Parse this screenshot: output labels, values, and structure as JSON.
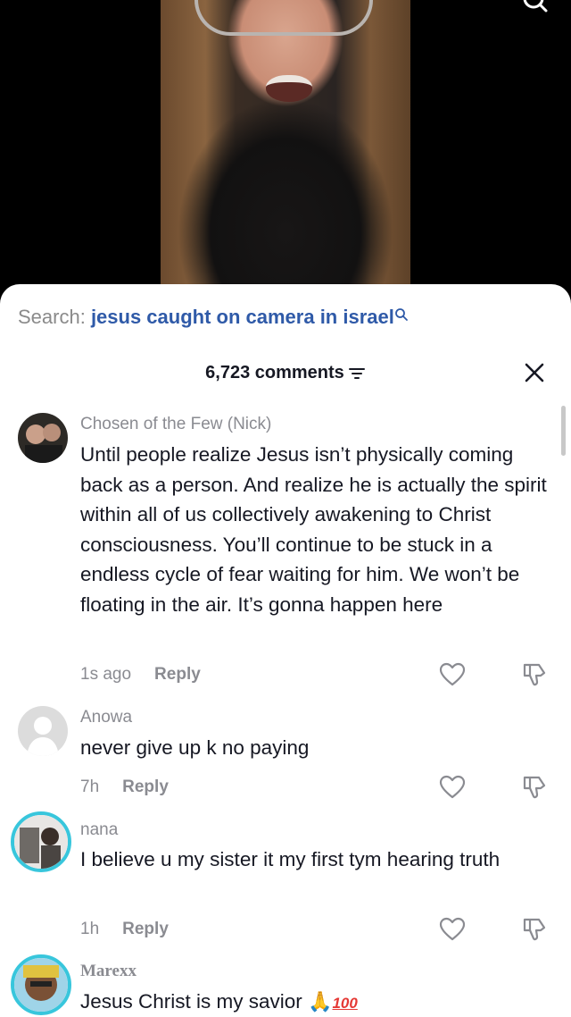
{
  "search": {
    "prefix": "Search: ",
    "query": "jesus caught on camera in israel"
  },
  "comments_header": {
    "count_label": "6,723 comments"
  },
  "comments": [
    {
      "username": "Chosen of the Few (Nick)",
      "text": "Until people realize Jesus isn’t physically coming back as a person. And realize he is actually the spirit within all of us collectively awakening to Christ consciousness. You’ll continue to be stuck in a endless cycle of fear waiting for him. We won’t be floating in the air. It’s gonna happen here",
      "time": "1s ago",
      "reply_label": "Reply"
    },
    {
      "username": "Anowa",
      "text": "never give up k no paying",
      "time": "7h",
      "reply_label": "Reply"
    },
    {
      "username": "nana",
      "text": "I believe u my sister it my first tym hearing truth",
      "time": "1h",
      "reply_label": "Reply"
    },
    {
      "username": "Marexx",
      "text": "Jesus Christ is my savior ",
      "emoji_pray": "🙏",
      "emoji_100": "100"
    }
  ],
  "colors": {
    "accent_link": "#2f5aa8",
    "secondary_text": "#8a8b91",
    "primary_text": "#161823",
    "avatar_ring": "#38c6dc"
  }
}
